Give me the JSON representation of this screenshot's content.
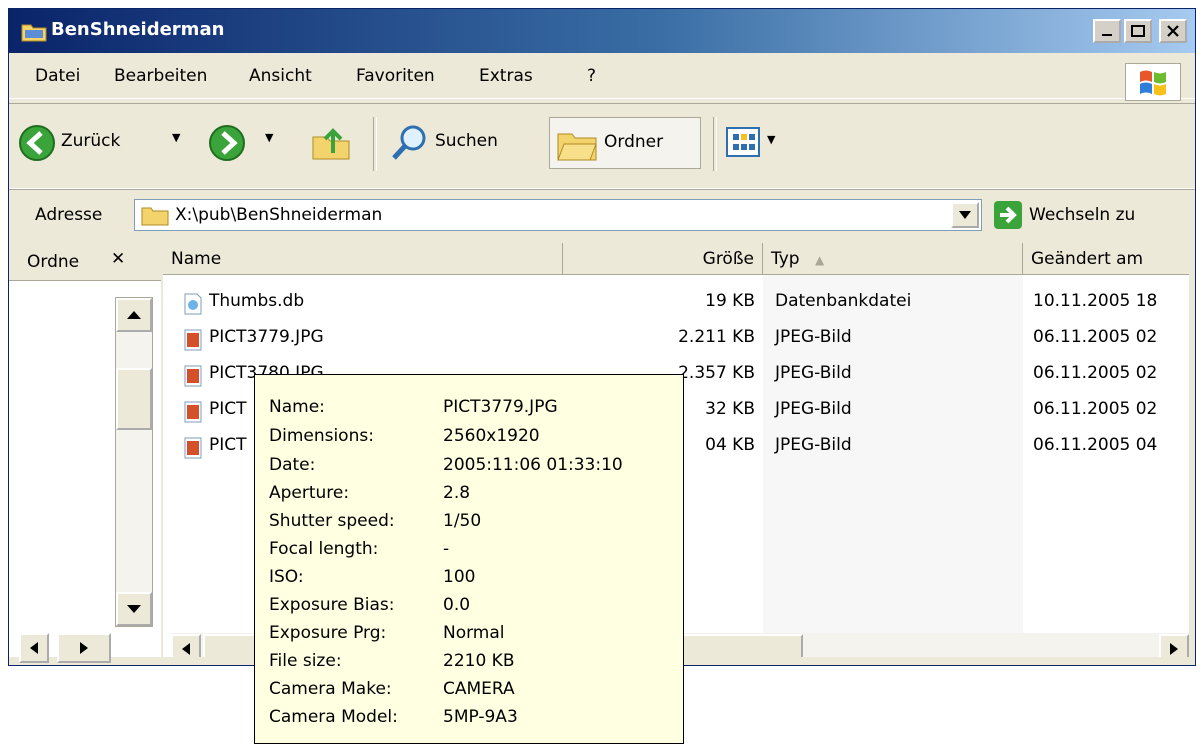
{
  "window": {
    "title": "BenShneiderman"
  },
  "menu": [
    "Datei",
    "Bearbeiten",
    "Ansicht",
    "Favoriten",
    "Extras",
    "?"
  ],
  "toolbar": {
    "back": "Zurück",
    "search": "Suchen",
    "folders": "Ordner"
  },
  "address": {
    "label": "Adresse",
    "value": "X:\\pub\\BenShneiderman",
    "go": "Wechseln zu"
  },
  "folders_pane": {
    "title": "Ordne"
  },
  "columns": {
    "name": "Name",
    "size": "Größe",
    "type": "Typ",
    "modified": "Geändert am"
  },
  "files": [
    {
      "name": "Thumbs.db",
      "size": "19 KB",
      "type": "Datenbankdatei",
      "modified": "10.11.2005 18",
      "icon": "database-file-icon"
    },
    {
      "name": "PICT3779.JPG",
      "size": "2.211 KB",
      "type": "JPEG-Bild",
      "modified": "06.11.2005 02",
      "icon": "jpeg-file-icon"
    },
    {
      "name": "PICT3780.JPG",
      "size": "2.357 KB",
      "type": "JPEG-Bild",
      "modified": "06.11.2005 02",
      "icon": "jpeg-file-icon"
    },
    {
      "name": "PICT",
      "size": "32 KB",
      "type": "JPEG-Bild",
      "modified": "06.11.2005 02",
      "icon": "jpeg-file-icon"
    },
    {
      "name": "PICT",
      "size": "04 KB",
      "type": "JPEG-Bild",
      "modified": "06.11.2005 04",
      "icon": "jpeg-file-icon"
    }
  ],
  "tooltip": [
    {
      "k": "Name:",
      "v": "PICT3779.JPG"
    },
    {
      "k": "Dimensions:",
      "v": "2560x1920"
    },
    {
      "k": "Date:",
      "v": "2005:11:06 01:33:10"
    },
    {
      "k": "Aperture:",
      "v": "2.8"
    },
    {
      "k": "Shutter speed:",
      "v": "1/50"
    },
    {
      "k": "Focal length:",
      "v": "-"
    },
    {
      "k": "ISO:",
      "v": "100"
    },
    {
      "k": "Exposure Bias:",
      "v": "0.0"
    },
    {
      "k": "Exposure Prg:",
      "v": "Normal"
    },
    {
      "k": "File size:",
      "v": "2210 KB"
    },
    {
      "k": "Camera Make:",
      "v": "CAMERA"
    },
    {
      "k": "Camera Model:",
      "v": "5MP-9A3"
    }
  ]
}
